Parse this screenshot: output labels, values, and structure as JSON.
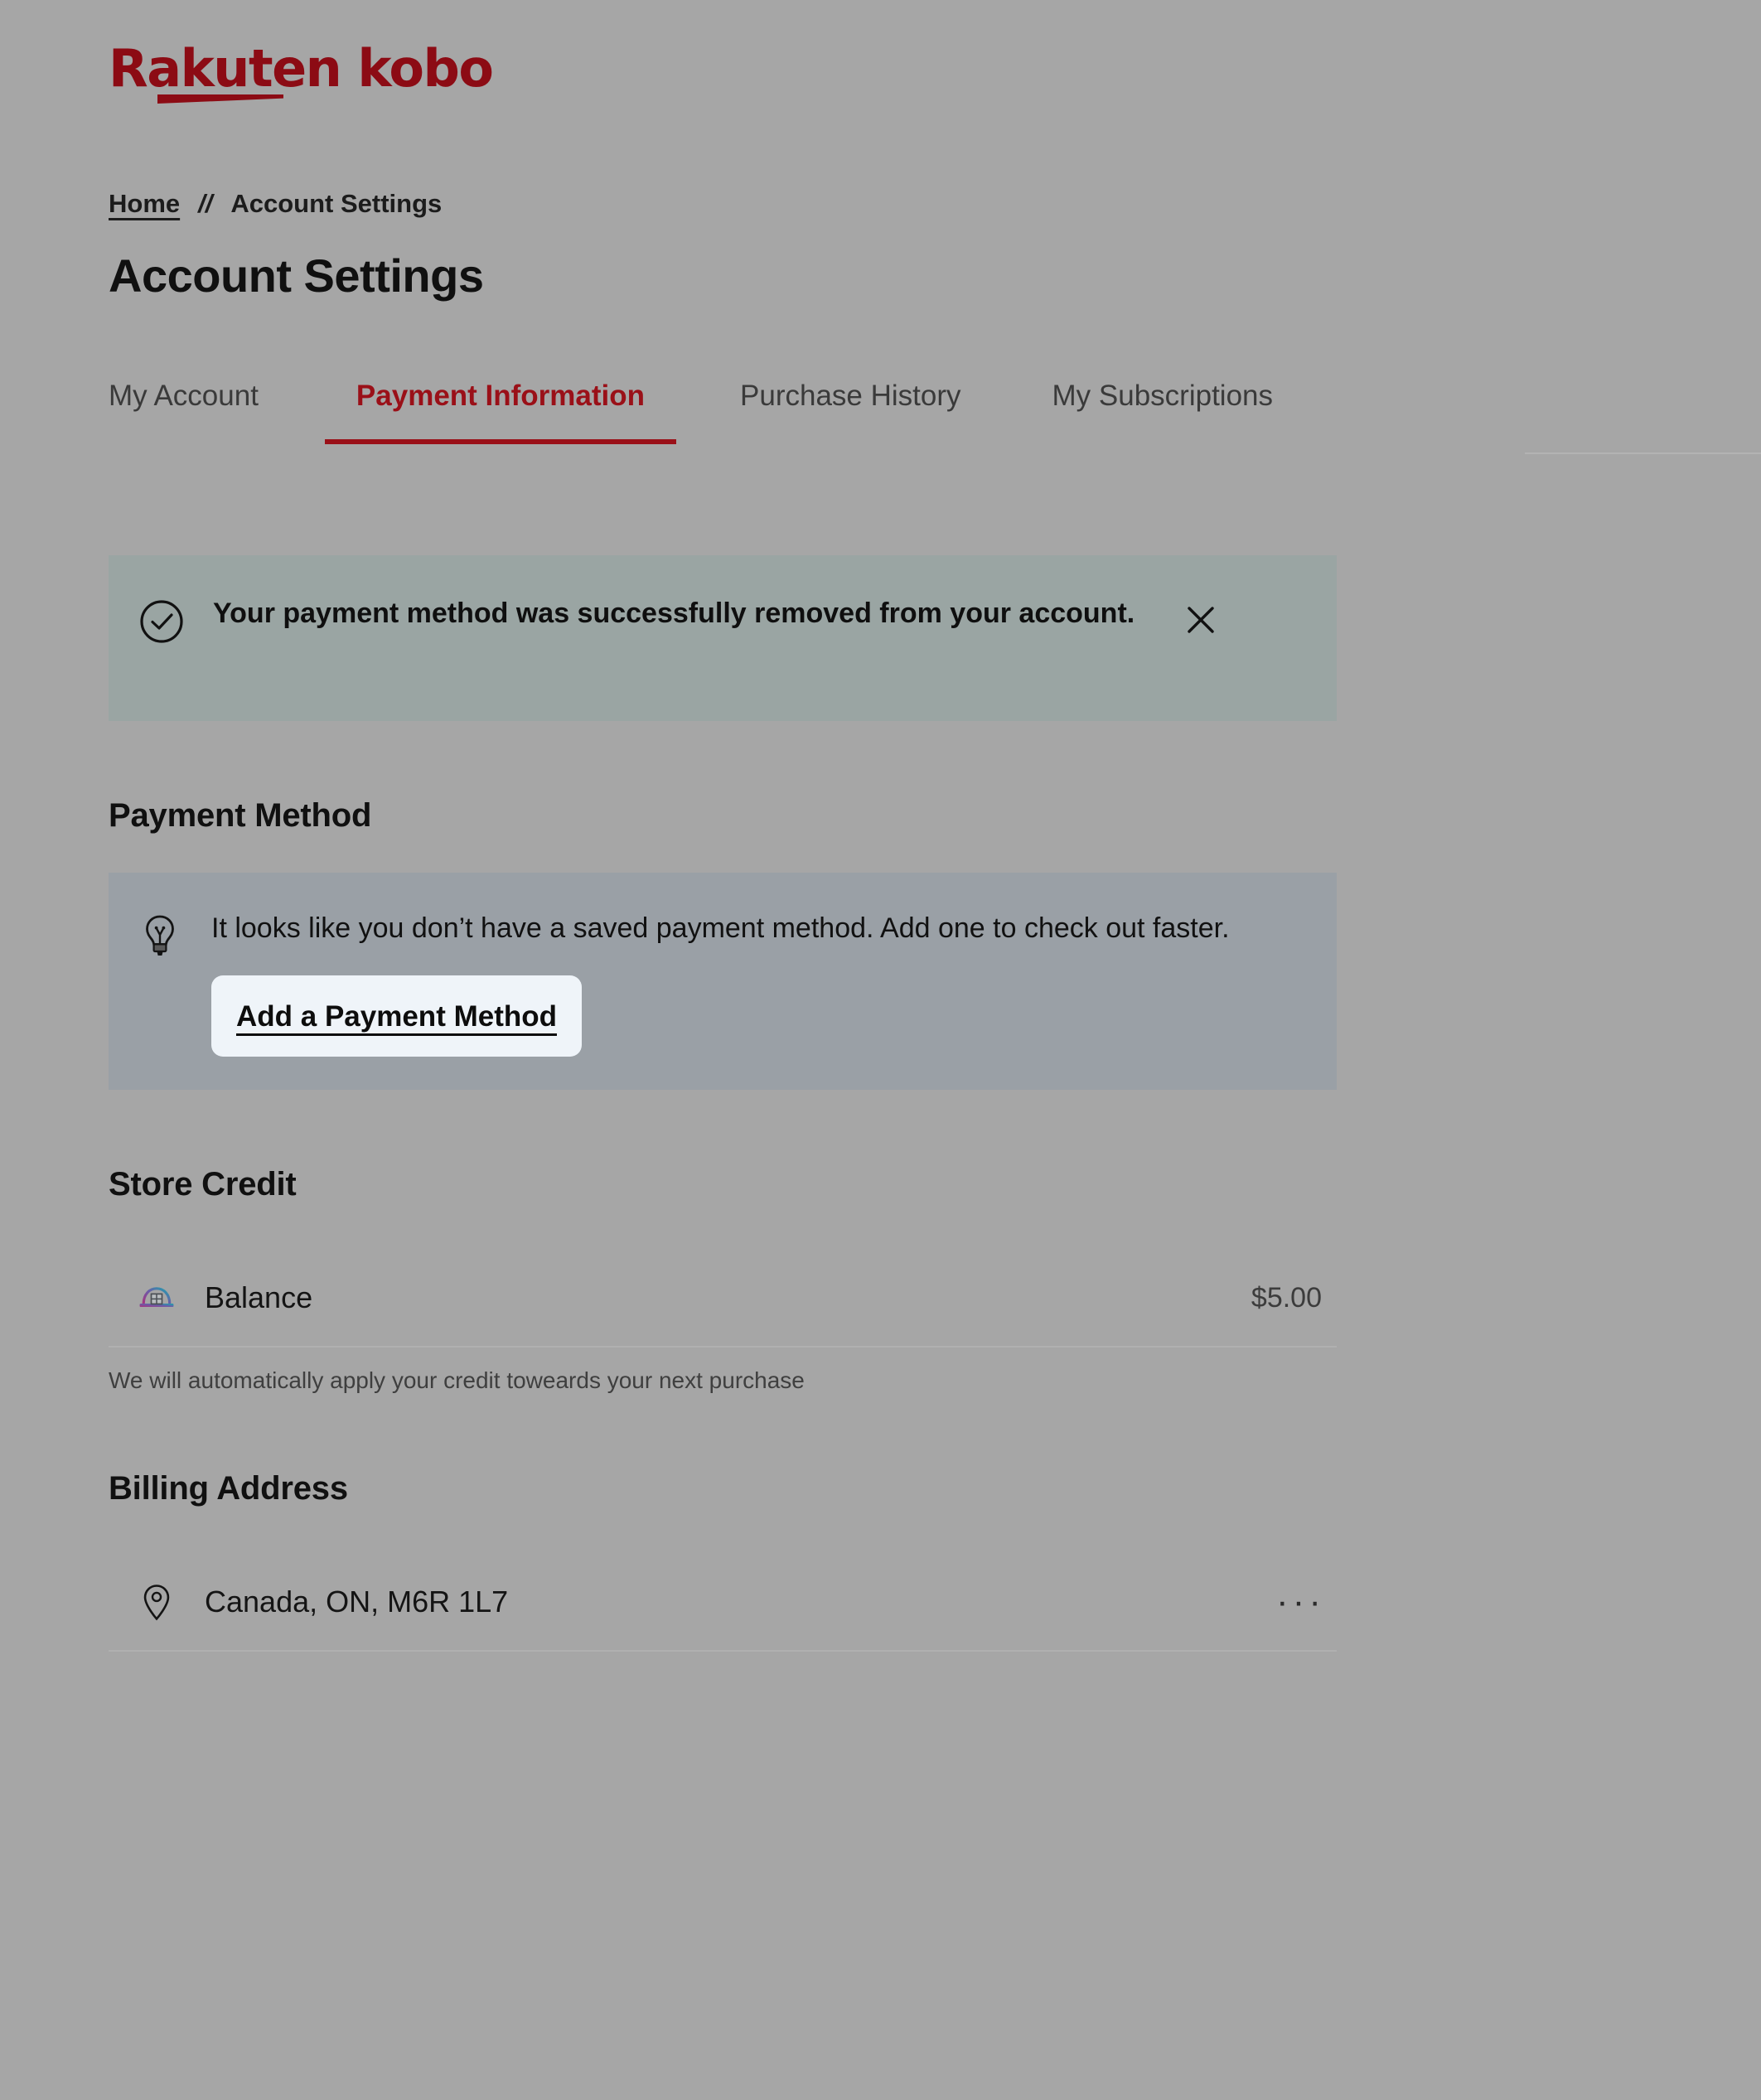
{
  "brand": {
    "logo_text": "Rakuten kobo",
    "logo_color": "#8c0b14"
  },
  "breadcrumb": {
    "home_label": "Home",
    "separator": "//",
    "current_label": "Account Settings"
  },
  "page": {
    "title": "Account Settings",
    "background_color": "#a6a6a6"
  },
  "tabs": [
    {
      "label": "My Account",
      "active": false
    },
    {
      "label": "Payment Information",
      "active": true
    },
    {
      "label": "Purchase History",
      "active": false
    },
    {
      "label": "My Subscriptions",
      "active": false
    }
  ],
  "tab_accent_color": "#9a1018",
  "banner": {
    "icon": "check-circle-icon",
    "message": "Your payment method was successfully removed from your account.",
    "close_icon": "close-icon",
    "background_color": "#9aa5a3"
  },
  "payment_method": {
    "heading": "Payment Method",
    "icon": "lightbulb-icon",
    "message": "It looks like you don’t have a saved payment method. Add one to check out faster.",
    "add_button_label": "Add a Payment Method",
    "box_background_color": "#9aa0a6",
    "button_highlight_color": "#eff4f9"
  },
  "store_credit": {
    "heading": "Store Credit",
    "balance_icon": "store-credit-icon",
    "balance_label": "Balance",
    "balance_value": "$5.00",
    "helper_text": "We will automatically apply your credit toweards your next purchase"
  },
  "billing_address": {
    "heading": "Billing Address",
    "pin_icon": "map-pin-icon",
    "address": "Canada, ON, M6R 1L7",
    "menu_label": "···"
  }
}
